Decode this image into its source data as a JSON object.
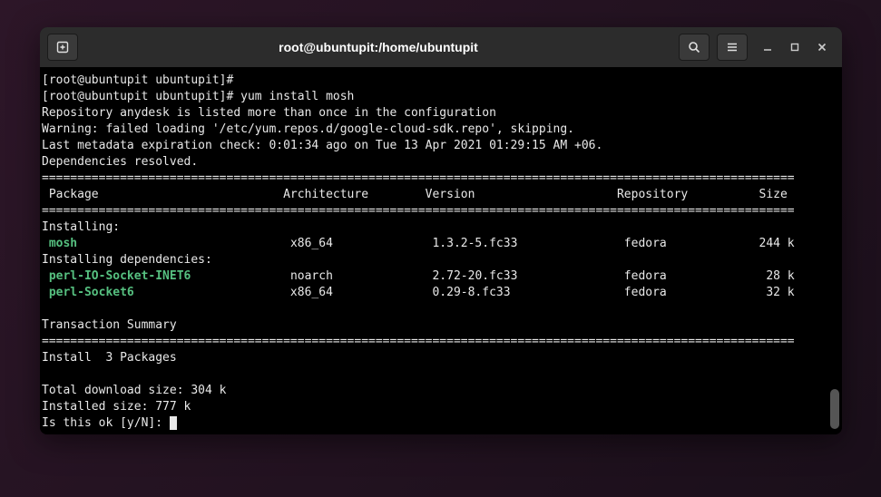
{
  "titlebar": {
    "title": "root@ubuntupit:/home/ubuntupit"
  },
  "terminal": {
    "prompt1": "[root@ubuntupit ubuntupit]#",
    "prompt2": "[root@ubuntupit ubuntupit]# yum install mosh",
    "line_repo": "Repository anydesk is listed more than once in the configuration",
    "line_warn": "Warning: failed loading '/etc/yum.repos.d/google-cloud-sdk.repo', skipping.",
    "line_meta": "Last metadata expiration check: 0:01:34 ago on Tue 13 Apr 2021 01:29:15 AM +06.",
    "line_deps": "Dependencies resolved.",
    "rule": "==========================================================================================================",
    "header": " Package                          Architecture        Version                    Repository          Size",
    "installing_hdr": "Installing:",
    "installing_deps_hdr": "Installing dependencies:",
    "pkg1_name": "mosh",
    "pkg1_rest": "                              x86_64              1.3.2-5.fc33               fedora             244 k",
    "pkg2_name": "perl-IO-Socket-INET6",
    "pkg2_rest": "              noarch              2.72-20.fc33               fedora              28 k",
    "pkg3_name": "perl-Socket6",
    "pkg3_rest": "                      x86_64              0.29-8.fc33                fedora              32 k",
    "trans_summary": "Transaction Summary",
    "install_count": "Install  3 Packages",
    "total_dl": "Total download size: 304 k",
    "installed_size": "Installed size: 777 k",
    "confirm": "Is this ok [y/N]: "
  }
}
